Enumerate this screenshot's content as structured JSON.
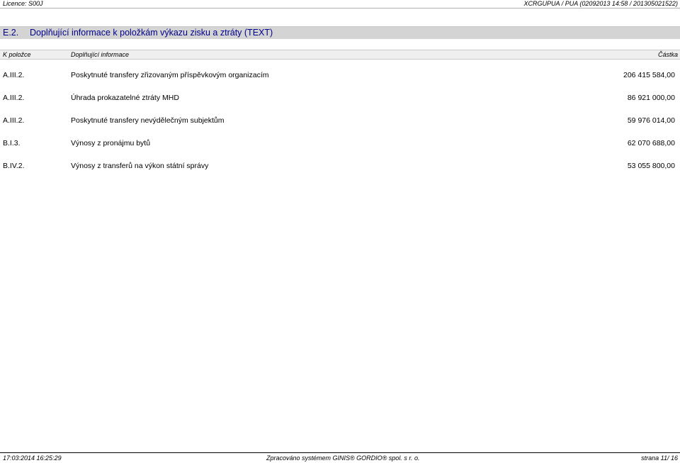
{
  "header": {
    "licence": "Licence: S00J",
    "report_id": "XCRGUPUA / PUA  (02092013 14:58 / 201305021522)"
  },
  "section": {
    "code": "E.2.",
    "title": "Doplňující informace k položkám výkazu zisku a ztráty (TEXT)"
  },
  "columns": {
    "item": "K položce",
    "info": "Doplňující informace",
    "amount": "Částka"
  },
  "rows": [
    {
      "code": "A.III.2.",
      "description": "Poskytnuté transfery zřizovaným příspěvkovým organizacím",
      "amount": "206 415 584,00"
    },
    {
      "code": "A.III.2.",
      "description": "Úhrada prokazatelné ztráty MHD",
      "amount": "86 921 000,00"
    },
    {
      "code": "A.III.2.",
      "description": "Poskytnuté transfery nevýdělečným subjektům",
      "amount": "59 976 014,00"
    },
    {
      "code": "B.I.3.",
      "description": "Výnosy z pronájmu bytů",
      "amount": "62 070 688,00"
    },
    {
      "code": "B.IV.2.",
      "description": "Výnosy z transferů na výkon státní správy",
      "amount": "53 055 800,00"
    }
  ],
  "footer": {
    "timestamp": "17:03:2014 16:25:29",
    "system": "Zpracováno systémem  GINIS® GORDIO® spol. s  r. o.",
    "page": "strana 11/ 16"
  }
}
